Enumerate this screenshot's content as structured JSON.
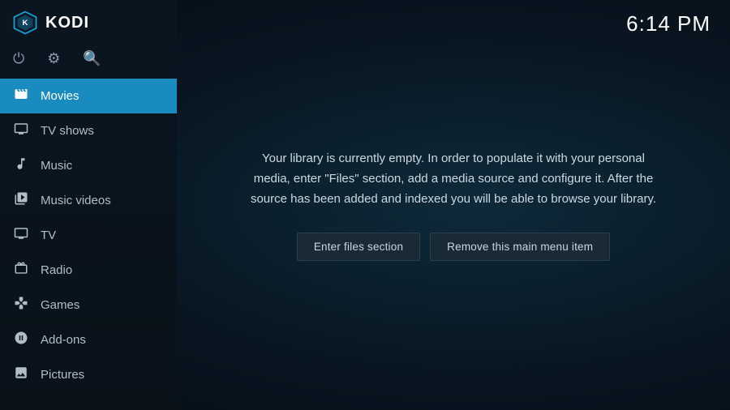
{
  "app": {
    "name": "KODI"
  },
  "clock": {
    "time": "6:14 PM"
  },
  "sidebar": {
    "items": [
      {
        "id": "movies",
        "label": "Movies",
        "icon": "movies",
        "active": true
      },
      {
        "id": "tvshows",
        "label": "TV shows",
        "icon": "tv",
        "active": false
      },
      {
        "id": "music",
        "label": "Music",
        "icon": "music",
        "active": false
      },
      {
        "id": "musicvideos",
        "label": "Music videos",
        "icon": "mvideo",
        "active": false
      },
      {
        "id": "tv",
        "label": "TV",
        "icon": "livetv",
        "active": false
      },
      {
        "id": "radio",
        "label": "Radio",
        "icon": "radio",
        "active": false
      },
      {
        "id": "games",
        "label": "Games",
        "icon": "games",
        "active": false
      },
      {
        "id": "addons",
        "label": "Add-ons",
        "icon": "addons",
        "active": false
      },
      {
        "id": "pictures",
        "label": "Pictures",
        "icon": "pictures",
        "active": false
      }
    ]
  },
  "main": {
    "empty_message": "Your library is currently empty. In order to populate it with your personal media, enter \"Files\" section, add a media source and configure it. After the source has been added and indexed you will be able to browse your library.",
    "btn_files": "Enter files section",
    "btn_remove": "Remove this main menu item"
  },
  "controls": {
    "power": "⏻",
    "settings": "⚙",
    "search": "🔍"
  }
}
